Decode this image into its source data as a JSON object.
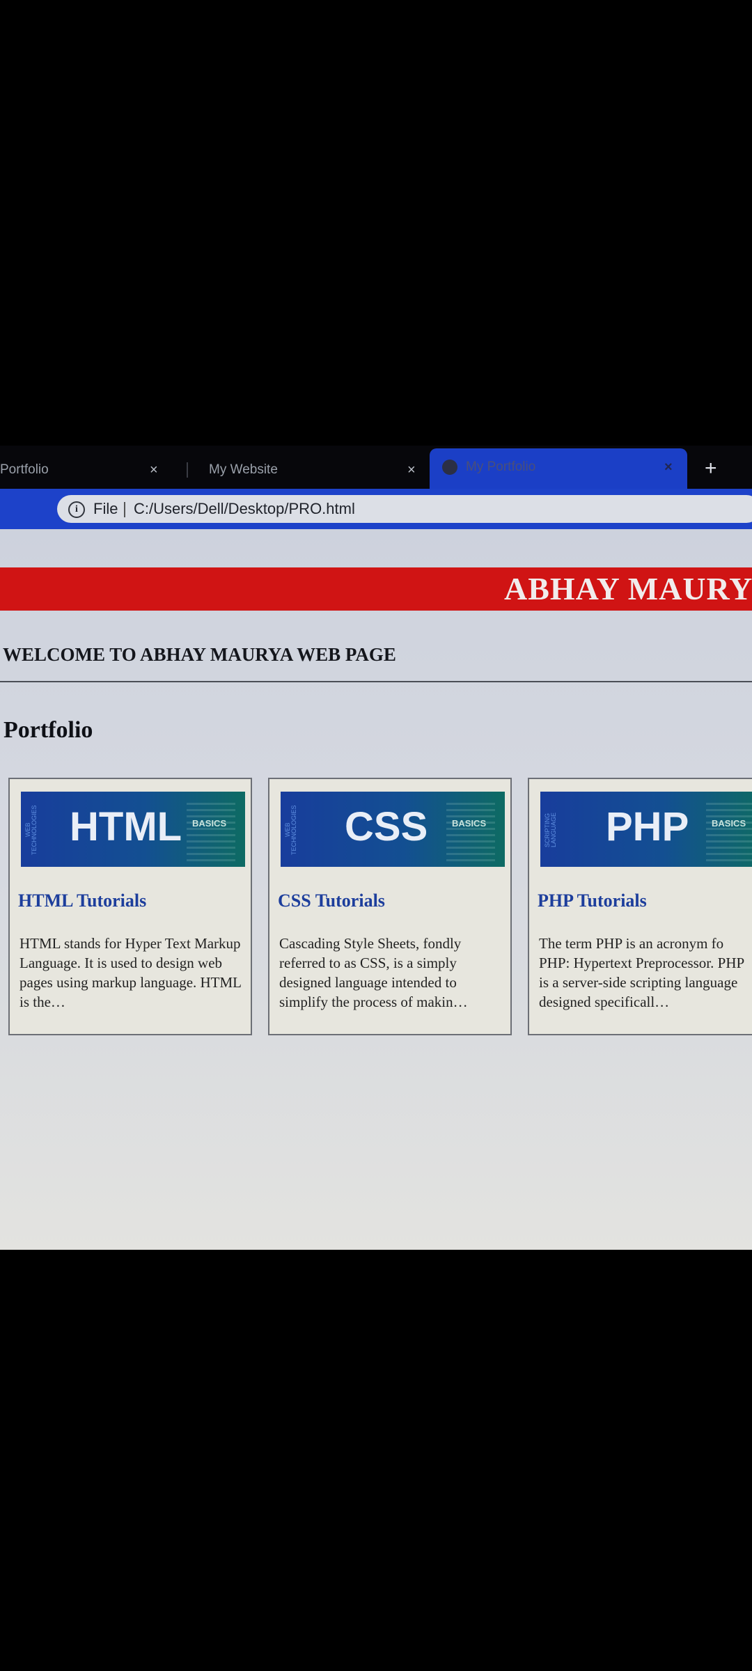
{
  "browser": {
    "tabs": [
      {
        "label": "Portfolio",
        "close": "×"
      },
      {
        "label": "My Website",
        "close": "×"
      },
      {
        "label": "My Portfolio",
        "close": "×",
        "active": true
      }
    ],
    "new_tab": "+",
    "address": {
      "scheme_label": "File",
      "url": "C:/Users/Dell/Desktop/PRO.html"
    }
  },
  "page": {
    "banner": "ABHAY MAURY",
    "welcome": "WELCOME TO ABHAY MAURYA WEB PAGE",
    "section_title": "Portfolio",
    "cards": [
      {
        "thumb_text": "HTML",
        "thumb_side": "WEB TECHNOLOGIES",
        "thumb_basics": "BASICS",
        "title": "HTML Tutorials",
        "desc": "HTML stands for Hyper Text Markup Language. It is used to design web pages using markup language. HTML is the…"
      },
      {
        "thumb_text": "CSS",
        "thumb_side": "WEB TECHNOLOGIES",
        "thumb_basics": "BASICS",
        "title": "CSS Tutorials",
        "desc": "Cascading Style Sheets, fondly referred to as CSS, is a simply designed language intended to simplify the process of makin…"
      },
      {
        "thumb_text": "PHP",
        "thumb_side": "SCRIPTING LANGUAGE",
        "thumb_basics": "BASICS",
        "title": "PHP Tutorials",
        "desc": "The term PHP is an acronym fo PHP: Hypertext Preprocessor. PHP is a server-side scripting language designed specificall…"
      }
    ]
  },
  "colors": {
    "banner": "#d01414",
    "card_title": "#1d3e9c",
    "active_tab": "#1b3fc6"
  }
}
